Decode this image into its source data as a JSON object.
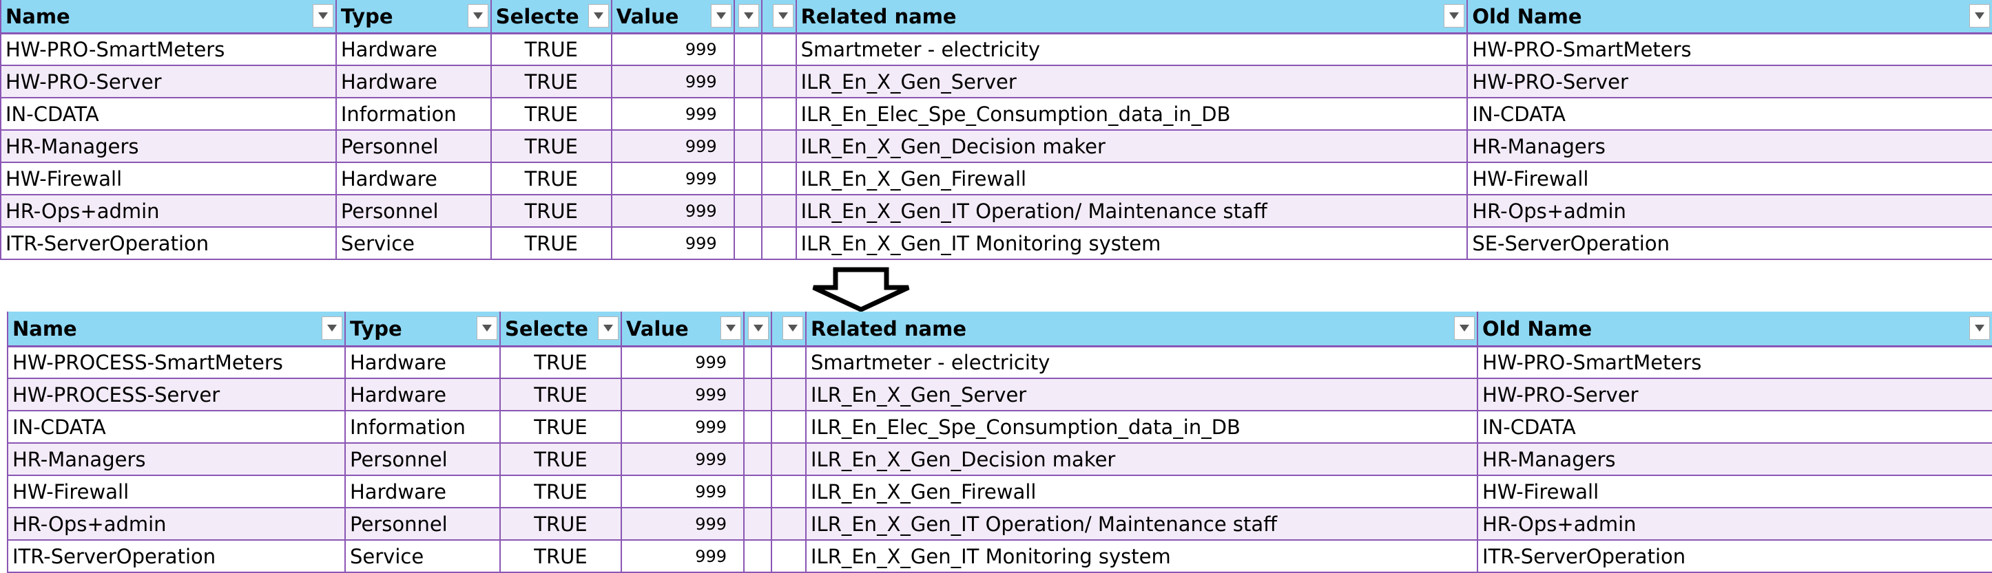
{
  "headers": {
    "name": "Name",
    "type": "Type",
    "selected": "Selecte",
    "value": "Value",
    "related_name": "Related name",
    "old_name": "Old Name"
  },
  "tables": [
    {
      "rows": [
        {
          "name": "HW-PRO-SmartMeters",
          "type": "Hardware",
          "selected": "TRUE",
          "value": "999",
          "related_name": "Smartmeter - electricity",
          "old_name": "HW-PRO-SmartMeters"
        },
        {
          "name": "HW-PRO-Server",
          "type": "Hardware",
          "selected": "TRUE",
          "value": "999",
          "related_name": "ILR_En_X_Gen_Server",
          "old_name": "HW-PRO-Server"
        },
        {
          "name": "IN-CDATA",
          "type": "Information",
          "selected": "TRUE",
          "value": "999",
          "related_name": "ILR_En_Elec_Spe_Consumption_data_in_DB",
          "old_name": "IN-CDATA"
        },
        {
          "name": "HR-Managers",
          "type": "Personnel",
          "selected": "TRUE",
          "value": "999",
          "related_name": "ILR_En_X_Gen_Decision maker",
          "old_name": "HR-Managers"
        },
        {
          "name": "HW-Firewall",
          "type": "Hardware",
          "selected": "TRUE",
          "value": "999",
          "related_name": "ILR_En_X_Gen_Firewall",
          "old_name": "HW-Firewall"
        },
        {
          "name": "HR-Ops+admin",
          "type": "Personnel",
          "selected": "TRUE",
          "value": "999",
          "related_name": "ILR_En_X_Gen_IT Operation/ Maintenance staff",
          "old_name": "HR-Ops+admin"
        },
        {
          "name": "ITR-ServerOperation",
          "type": "Service",
          "selected": "TRUE",
          "value": "999",
          "related_name": "ILR_En_X_Gen_IT Monitoring system",
          "old_name": "SE-ServerOperation"
        }
      ]
    },
    {
      "rows": [
        {
          "name": "HW-PROCESS-SmartMeters",
          "type": "Hardware",
          "selected": "TRUE",
          "value": "999",
          "related_name": "Smartmeter - electricity",
          "old_name": "HW-PRO-SmartMeters"
        },
        {
          "name": "HW-PROCESS-Server",
          "type": "Hardware",
          "selected": "TRUE",
          "value": "999",
          "related_name": "ILR_En_X_Gen_Server",
          "old_name": "HW-PRO-Server"
        },
        {
          "name": "IN-CDATA",
          "type": "Information",
          "selected": "TRUE",
          "value": "999",
          "related_name": "ILR_En_Elec_Spe_Consumption_data_in_DB",
          "old_name": "IN-CDATA"
        },
        {
          "name": "HR-Managers",
          "type": "Personnel",
          "selected": "TRUE",
          "value": "999",
          "related_name": "ILR_En_X_Gen_Decision maker",
          "old_name": "HR-Managers"
        },
        {
          "name": "HW-Firewall",
          "type": "Hardware",
          "selected": "TRUE",
          "value": "999",
          "related_name": "ILR_En_X_Gen_Firewall",
          "old_name": "HW-Firewall"
        },
        {
          "name": "HR-Ops+admin",
          "type": "Personnel",
          "selected": "TRUE",
          "value": "999",
          "related_name": "ILR_En_X_Gen_IT Operation/ Maintenance staff",
          "old_name": "HR-Ops+admin"
        },
        {
          "name": "ITR-ServerOperation",
          "type": "Service",
          "selected": "TRUE",
          "value": "999",
          "related_name": "ILR_En_X_Gen_IT Monitoring system",
          "old_name": "ITR-ServerOperation"
        }
      ]
    }
  ]
}
